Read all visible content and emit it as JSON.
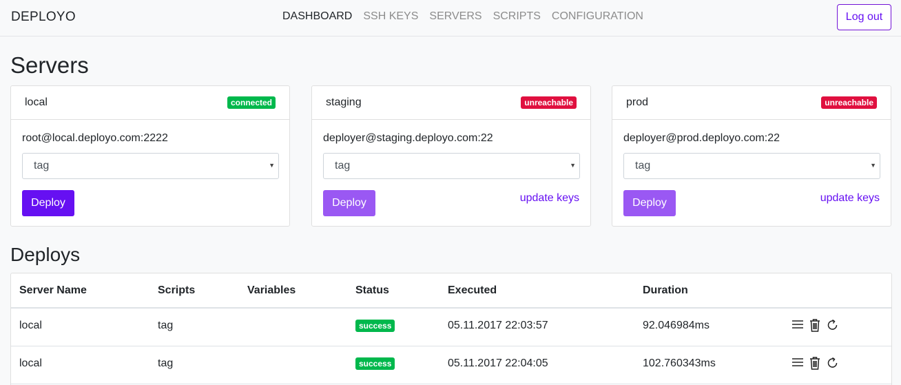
{
  "nav": {
    "brand": "DEPLOYO",
    "links": [
      "DASHBOARD",
      "SSH KEYS",
      "SERVERS",
      "SCRIPTS",
      "CONFIGURATION"
    ],
    "logout_label": "Log out"
  },
  "servers": {
    "title": "Servers",
    "cards": [
      {
        "name": "local",
        "status": "connected",
        "host": "root@local.deployo.com:2222",
        "select_value": "tag",
        "deploy_label": "Deploy",
        "update_label": ""
      },
      {
        "name": "staging",
        "status": "unreachable",
        "host": "deployer@staging.deployo.com:22",
        "select_value": "tag",
        "deploy_label": "Deploy",
        "update_label": "update keys"
      },
      {
        "name": "prod",
        "status": "unreachable",
        "host": "deployer@prod.deployo.com:22",
        "select_value": "tag",
        "deploy_label": "Deploy",
        "update_label": "update keys"
      }
    ]
  },
  "deploys": {
    "title": "Deploys",
    "columns": [
      "Server Name",
      "Scripts",
      "Variables",
      "Status",
      "Executed",
      "Duration"
    ],
    "rows": [
      {
        "server": "local",
        "scripts": "tag",
        "variables": "",
        "status": "success",
        "executed": "05.11.2017 22:03:57",
        "duration": "92.046984ms"
      },
      {
        "server": "local",
        "scripts": "tag",
        "variables": "",
        "status": "success",
        "executed": "05.11.2017 22:04:05",
        "duration": "102.760343ms"
      }
    ]
  },
  "colors": {
    "accent": "#6610f2",
    "success": "#00b84c",
    "danger": "#e0103f"
  },
  "icons": [
    "list-icon",
    "trash-icon",
    "refresh-icon",
    "dropdown-caret-icon"
  ]
}
